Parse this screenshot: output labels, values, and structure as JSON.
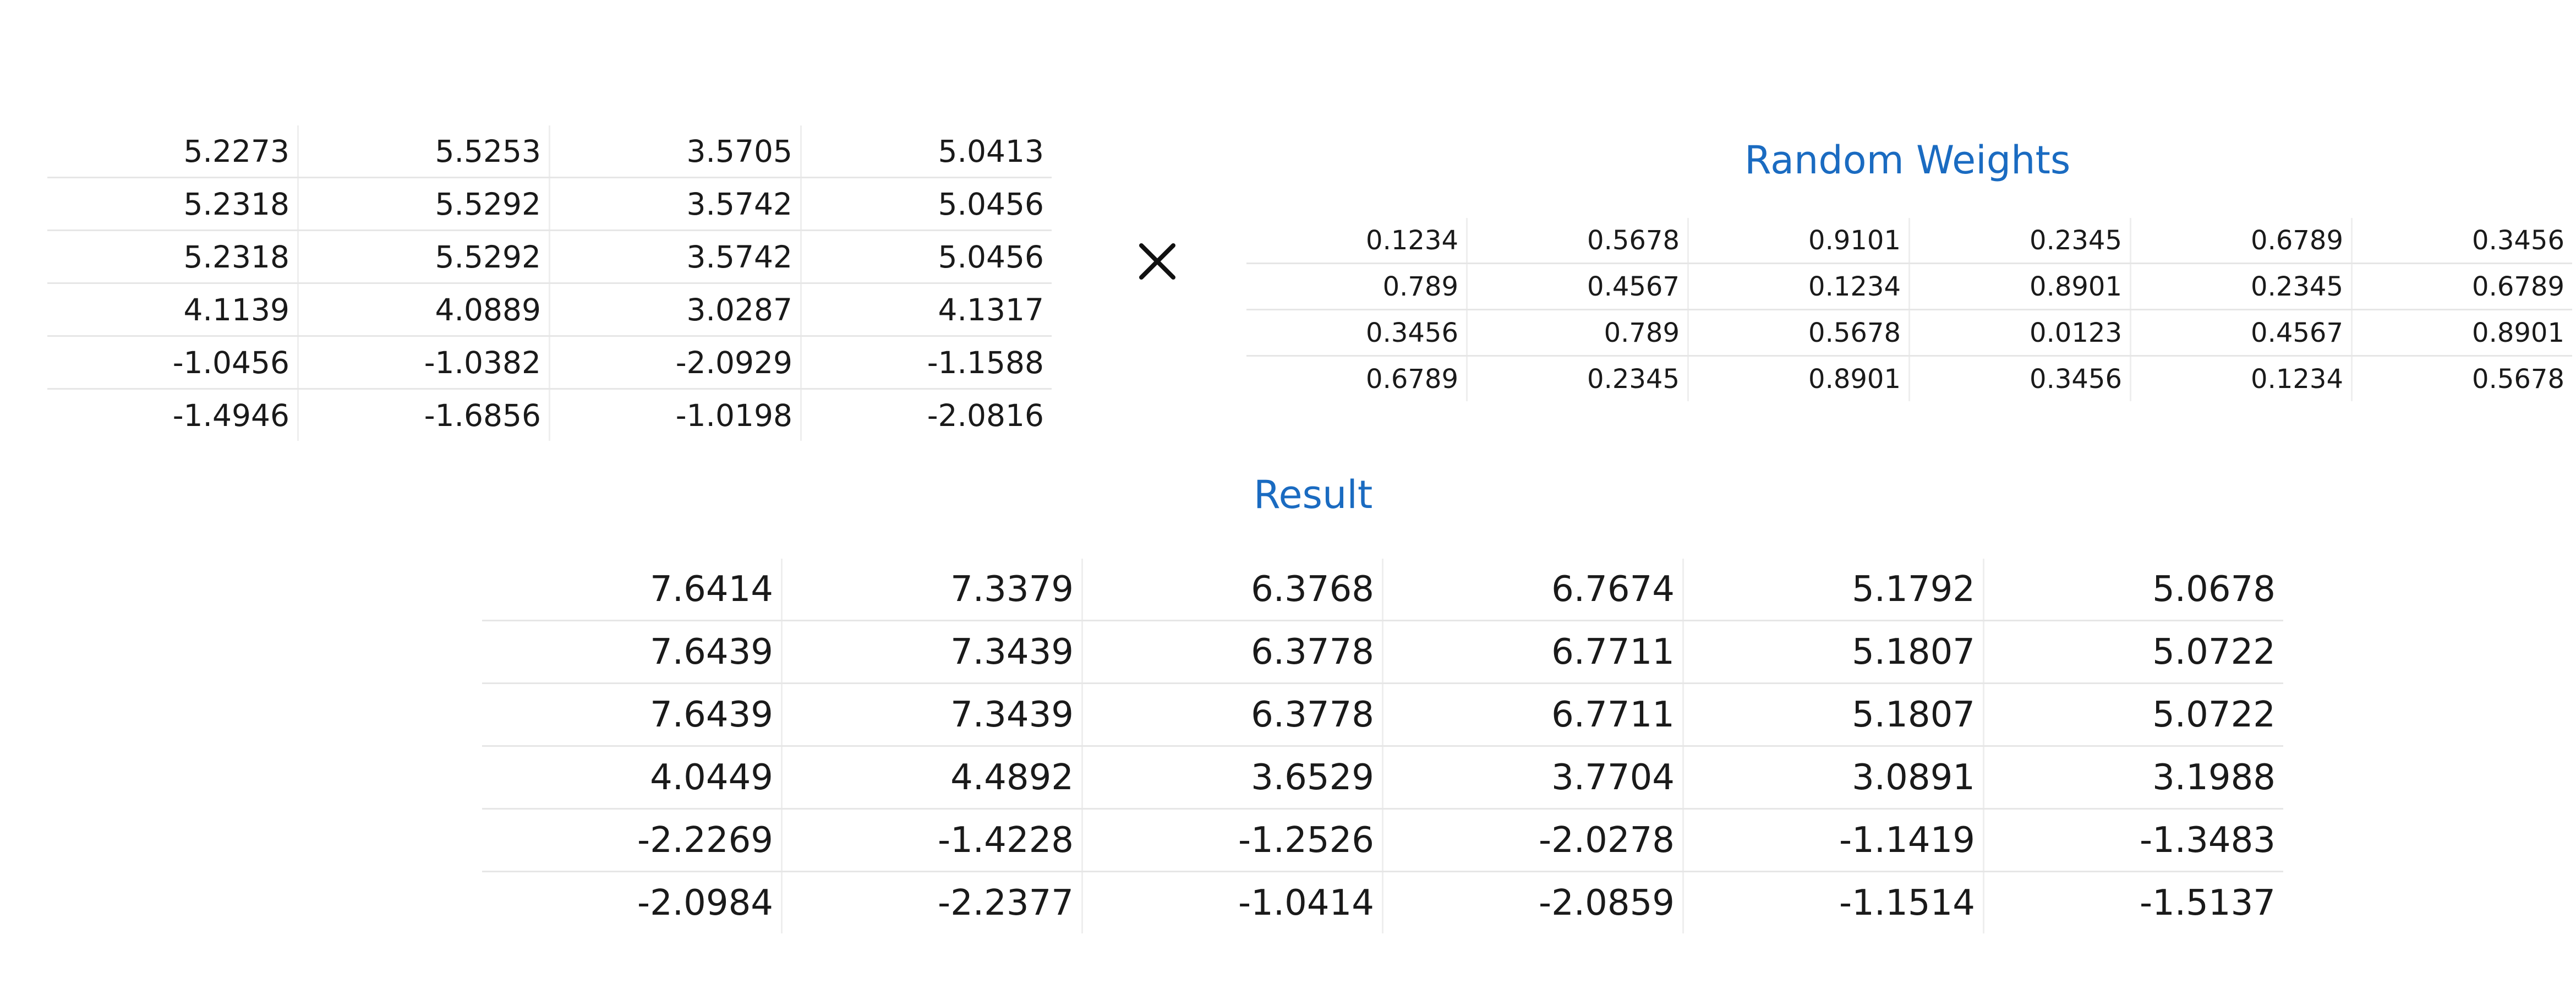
{
  "operator_glyph": "×",
  "input_matrix": [
    [
      "5.2273",
      "5.5253",
      "3.5705",
      "5.0413"
    ],
    [
      "5.2318",
      "5.5292",
      "3.5742",
      "5.0456"
    ],
    [
      "5.2318",
      "5.5292",
      "3.5742",
      "5.0456"
    ],
    [
      "4.1139",
      "4.0889",
      "3.0287",
      "4.1317"
    ],
    [
      "-1.0456",
      "-1.0382",
      "-2.0929",
      "-1.1588"
    ],
    [
      "-1.4946",
      "-1.6856",
      "-1.0198",
      "-2.0816"
    ]
  ],
  "weights": {
    "title": "Random Weights",
    "rows": [
      [
        "0.1234",
        "0.5678",
        "0.9101",
        "0.2345",
        "0.6789",
        "0.3456"
      ],
      [
        "0.789",
        "0.4567",
        "0.1234",
        "0.8901",
        "0.2345",
        "0.6789"
      ],
      [
        "0.3456",
        "0.789",
        "0.5678",
        "0.0123",
        "0.4567",
        "0.8901"
      ],
      [
        "0.6789",
        "0.2345",
        "0.8901",
        "0.3456",
        "0.1234",
        "0.5678"
      ]
    ]
  },
  "result": {
    "title": "Result",
    "rows": [
      [
        "7.6414",
        "7.3379",
        "6.3768",
        "6.7674",
        "5.1792",
        "5.0678"
      ],
      [
        "7.6439",
        "7.3439",
        "6.3778",
        "6.7711",
        "5.1807",
        "5.0722"
      ],
      [
        "7.6439",
        "7.3439",
        "6.3778",
        "6.7711",
        "5.1807",
        "5.0722"
      ],
      [
        "4.0449",
        "4.4892",
        "3.6529",
        "3.7704",
        "3.0891",
        "3.1988"
      ],
      [
        "-2.2269",
        "-1.4228",
        "-1.2526",
        "-2.0278",
        "-1.1419",
        "-1.3483"
      ],
      [
        "-2.0984",
        "-2.2377",
        "-1.0414",
        "-2.0859",
        "-1.1514",
        "-1.5137"
      ]
    ]
  },
  "colors": {
    "heading": "#1a6bc1",
    "text": "#1a1a1a",
    "grid_line": "#e6e6e6"
  }
}
